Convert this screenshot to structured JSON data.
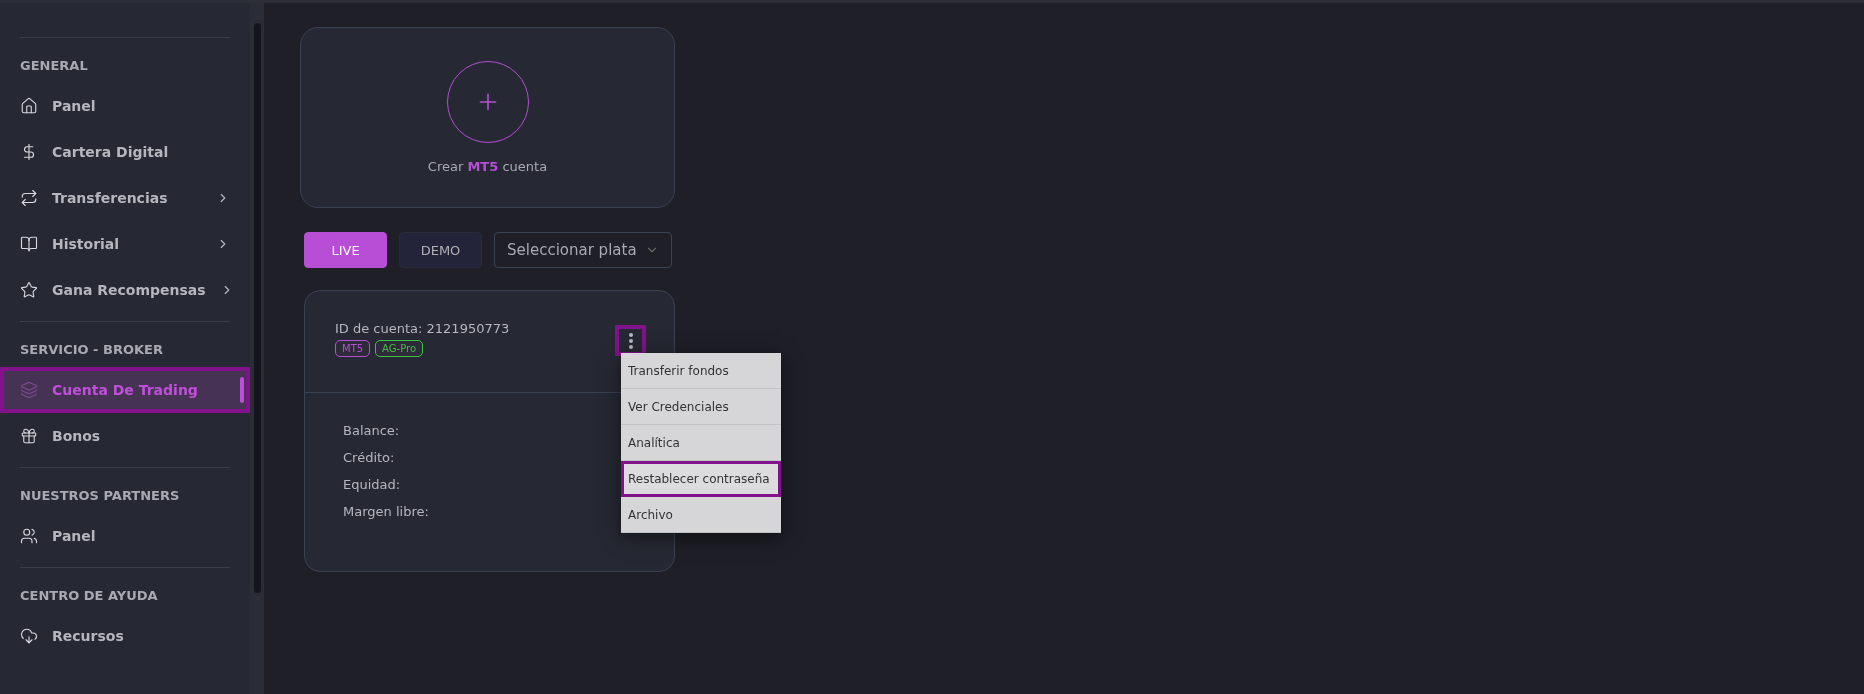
{
  "sidebar": {
    "sections": [
      {
        "title": "GENERAL",
        "items": [
          {
            "label": "Panel",
            "chevron": false,
            "selected": false,
            "highlighted": false
          },
          {
            "label": "Cartera Digital",
            "chevron": false,
            "selected": false,
            "highlighted": false
          },
          {
            "label": "Transferencias",
            "chevron": true,
            "selected": false,
            "highlighted": false
          },
          {
            "label": "Historial",
            "chevron": true,
            "selected": false,
            "highlighted": false
          },
          {
            "label": "Gana Recompensas",
            "chevron": true,
            "selected": false,
            "highlighted": false
          }
        ]
      },
      {
        "title": "SERVICIO - BROKER",
        "items": [
          {
            "label": "Cuenta De Trading",
            "chevron": false,
            "selected": true,
            "highlighted": true
          },
          {
            "label": "Bonos",
            "chevron": false,
            "selected": false,
            "highlighted": false
          }
        ]
      },
      {
        "title": "NUESTROS PARTNERS",
        "items": [
          {
            "label": "Panel",
            "chevron": false,
            "selected": false,
            "highlighted": false
          }
        ]
      },
      {
        "title": "CENTRO DE AYUDA",
        "items": [
          {
            "label": "Recursos",
            "chevron": false,
            "selected": false,
            "highlighted": false
          }
        ]
      }
    ]
  },
  "create_card": {
    "label": "Crear **MT5** cuenta"
  },
  "tabs": [
    {
      "label": "LIVE",
      "selected": true
    },
    {
      "label": "DEMO",
      "selected": false
    }
  ],
  "platform_select": {
    "placeholder": "Seleccionar plata"
  },
  "account_card": {
    "id_label": "ID de cuenta: 2121950773",
    "tags": [
      {
        "label": "MT5",
        "color": "#b44fd6"
      },
      {
        "label": "AG-Pro",
        "color": "#3fbf3f"
      }
    ],
    "more_button": {
      "highlighted": true
    },
    "rows": [
      "Balance:",
      "Crédito:",
      "Equidad:",
      "Margen libre:"
    ],
    "menu": [
      {
        "label": "Transferir fondos",
        "highlighted": false
      },
      {
        "label": "Ver Credenciales",
        "highlighted": false
      },
      {
        "label": "Analítica",
        "highlighted": false
      },
      {
        "label": "Restablecer contraseña",
        "highlighted": true
      },
      {
        "label": "Archivo",
        "highlighted": false
      }
    ]
  }
}
